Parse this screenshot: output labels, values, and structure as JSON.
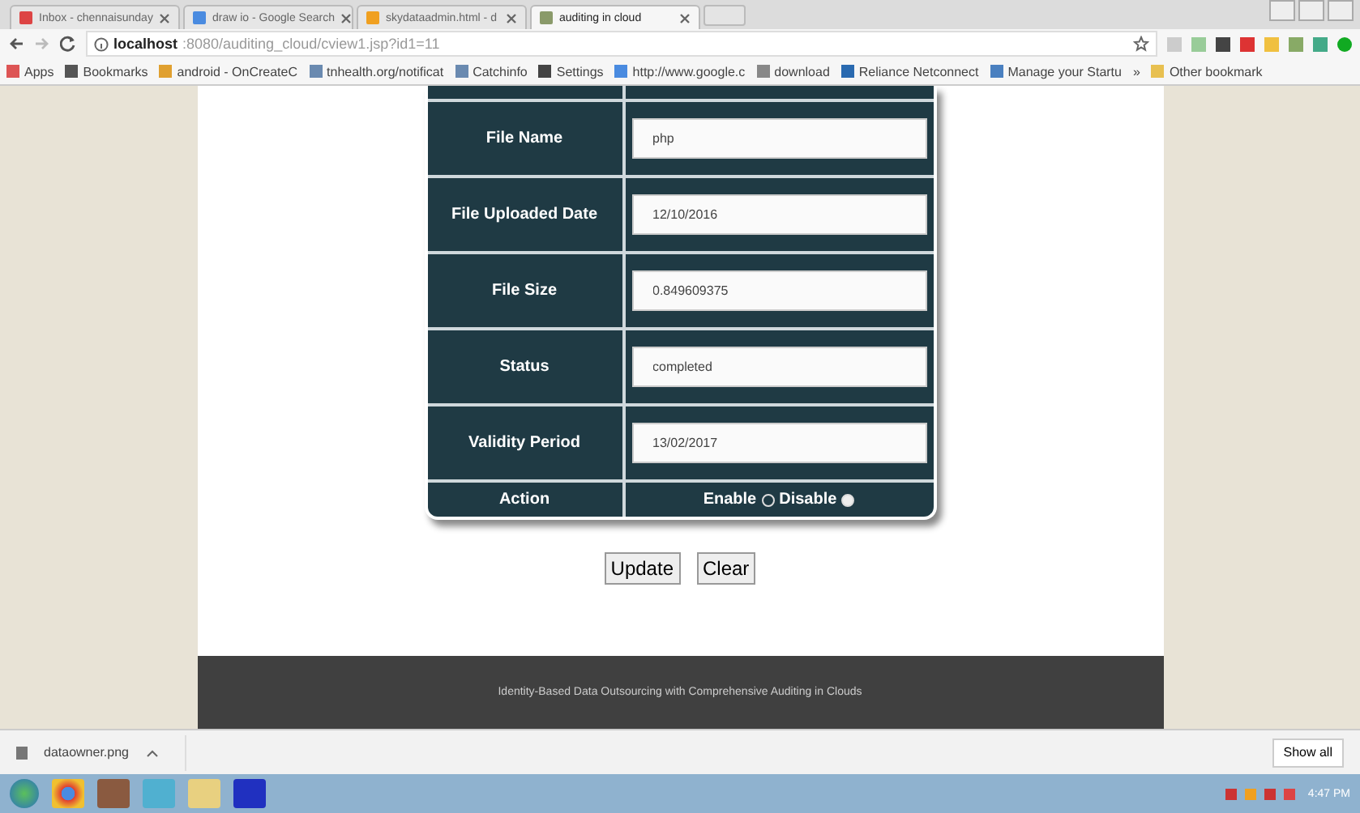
{
  "browser": {
    "tabs": [
      {
        "label": "Inbox - chennaisunday",
        "selected": false,
        "kind": "mail"
      },
      {
        "label": "draw io - Google Search",
        "selected": false,
        "kind": "search"
      },
      {
        "label": "skydataadmin.html - d",
        "selected": false,
        "kind": "orange"
      },
      {
        "label": "auditing in cloud",
        "selected": true,
        "kind": "page"
      }
    ],
    "url_host": "localhost",
    "url_path": ":8080/auditing_cloud/cview1.jsp?id1=11",
    "bookmarks": [
      {
        "label": "Apps",
        "kind": "apps"
      },
      {
        "label": "Bookmarks",
        "kind": "star"
      },
      {
        "label": "android - OnCreateC",
        "kind": "android"
      },
      {
        "label": "tnhealth.org/notificat",
        "kind": "page"
      },
      {
        "label": "Catchinfo",
        "kind": "page"
      },
      {
        "label": "Settings",
        "kind": "gear"
      },
      {
        "label": "http://www.google.c",
        "kind": "google"
      },
      {
        "label": "download",
        "kind": "doc"
      },
      {
        "label": "Reliance Netconnect",
        "kind": "blue"
      },
      {
        "label": "Manage your Startu",
        "kind": "diamond"
      },
      {
        "label": "»",
        "kind": "more"
      },
      {
        "label": "Other bookmark",
        "kind": "folder"
      }
    ]
  },
  "form": {
    "fields": [
      {
        "label": "File Name",
        "value": "php"
      },
      {
        "label": "File Uploaded Date",
        "value": "12/10/2016"
      },
      {
        "label": "File Size",
        "value": "0.849609375"
      },
      {
        "label": "Status",
        "value": "completed"
      },
      {
        "label": "Validity Period",
        "value": "13/02/2017"
      }
    ],
    "action": {
      "label": "Action",
      "options": [
        {
          "label": "Enable",
          "selected": false
        },
        {
          "label": "Disable",
          "selected": true
        }
      ]
    },
    "buttons": [
      "Update",
      "Clear"
    ]
  },
  "footer": "Identity-Based Data Outsourcing with Comprehensive Auditing in Clouds",
  "downloads": {
    "file": "dataowner.png",
    "show_all": "Show all"
  },
  "taskbar": {
    "time": "4:47 PM"
  }
}
